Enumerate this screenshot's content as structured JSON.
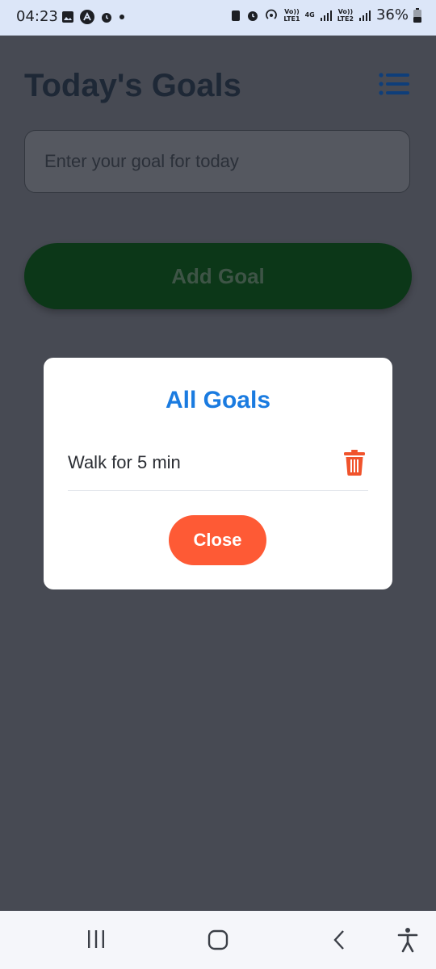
{
  "status_bar": {
    "time": "04:23",
    "volte1": "Vo))\nLTE1",
    "network": "4G",
    "volte2": "Vo))\nLTE2",
    "battery": "36%"
  },
  "app": {
    "title": "Today's Goals",
    "goal_input": {
      "placeholder": "Enter your goal for today",
      "value": ""
    },
    "add_button_label": "Add Goal"
  },
  "modal": {
    "title": "All Goals",
    "goals": [
      {
        "text": "Walk for 5 min"
      }
    ],
    "close_label": "Close"
  },
  "colors": {
    "modal_title": "#1a7be0",
    "close_button": "#fe5a35",
    "trash_icon": "#f0532c",
    "overlay_background": "#474a53"
  },
  "icons": [
    "gallery-icon",
    "a-icon",
    "alarm-icon",
    "menu-list-icon",
    "trash-icon",
    "recents-icon",
    "home-icon",
    "back-icon",
    "accessibility-icon"
  ]
}
